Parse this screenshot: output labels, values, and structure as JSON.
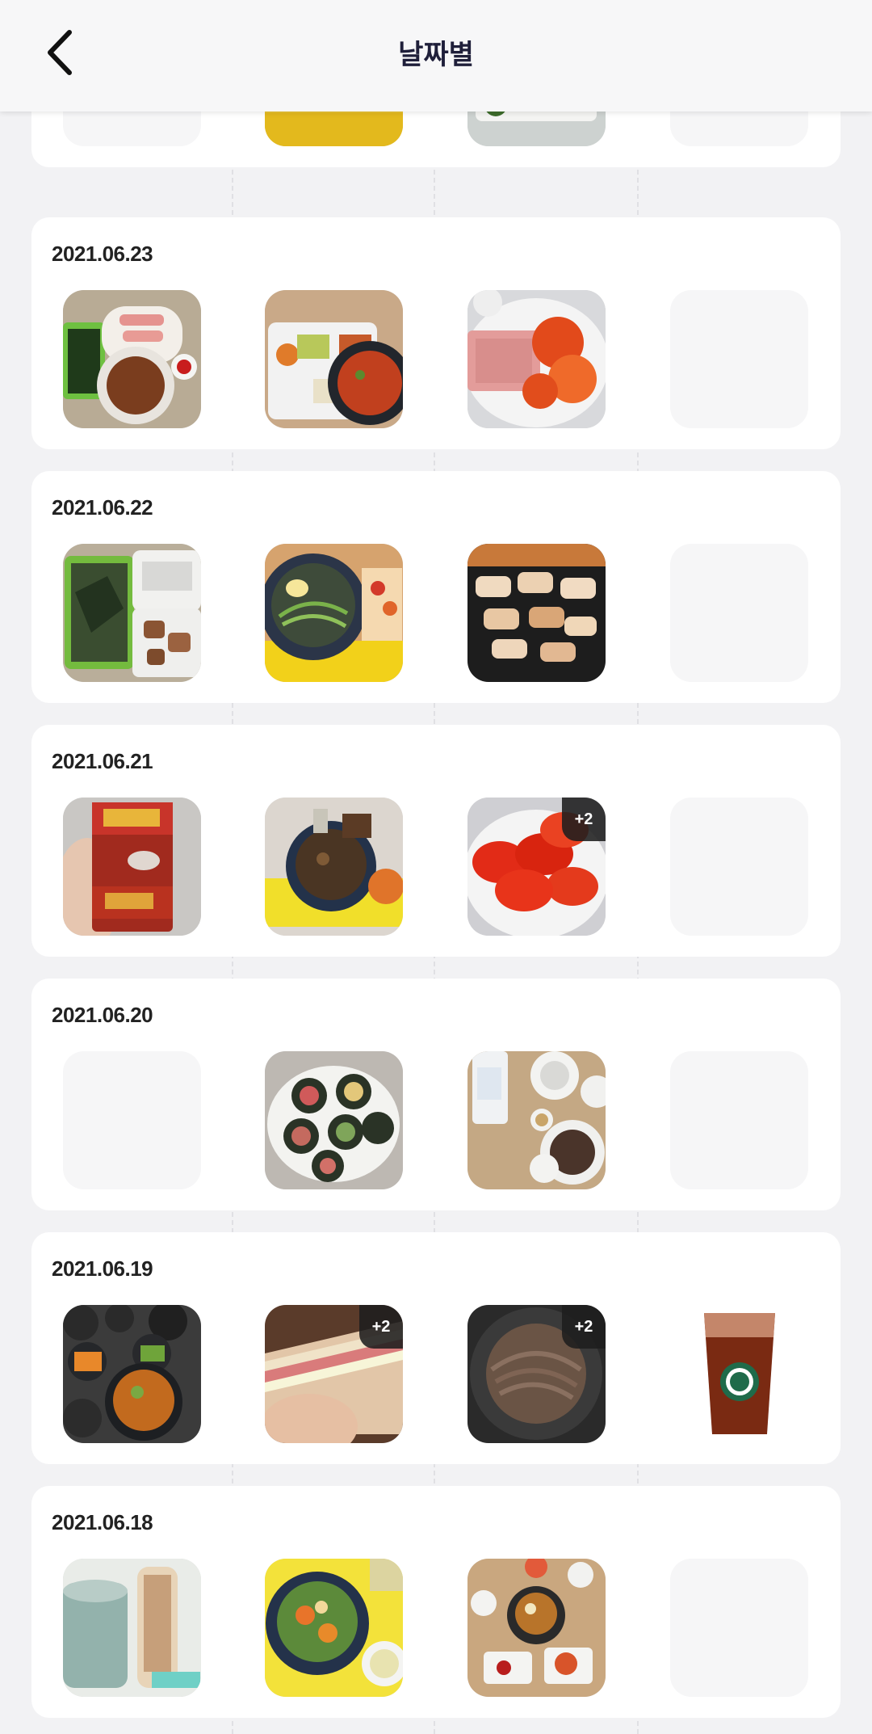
{
  "header": {
    "title": "날짜별",
    "back_icon": "chevron-left-icon"
  },
  "colors": {
    "title": "#1f1f3a",
    "background": "#f2f2f4",
    "card": "#ffffff",
    "empty_tile": "#f6f6f7"
  },
  "days": [
    {
      "date": "",
      "tiles": [
        {
          "kind": "empty"
        },
        {
          "kind": "photo",
          "subject": "tray-red-soup"
        },
        {
          "kind": "photo",
          "subject": "fish-sashimi-plate"
        },
        {
          "kind": "empty"
        }
      ]
    },
    {
      "date": "2021.06.23",
      "tiles": [
        {
          "kind": "photo",
          "subject": "lunchbox-seaweed-ham"
        },
        {
          "kind": "photo",
          "subject": "white-tray-spicy-stew"
        },
        {
          "kind": "photo",
          "subject": "spam-and-tomato"
        },
        {
          "kind": "empty"
        }
      ]
    },
    {
      "date": "2021.06.22",
      "tiles": [
        {
          "kind": "photo",
          "subject": "seaweed-box-meat"
        },
        {
          "kind": "photo",
          "subject": "cold-noodles-tray"
        },
        {
          "kind": "photo",
          "subject": "grilled-pork-belly"
        },
        {
          "kind": "empty"
        }
      ]
    },
    {
      "date": "2021.06.21",
      "tiles": [
        {
          "kind": "photo",
          "subject": "snack-package"
        },
        {
          "kind": "photo",
          "subject": "soup-bowl-yellow-tray"
        },
        {
          "kind": "photo",
          "subject": "sliced-tomatoes",
          "badge": "+2"
        },
        {
          "kind": "empty"
        }
      ]
    },
    {
      "date": "2021.06.20",
      "tiles": [
        {
          "kind": "empty"
        },
        {
          "kind": "photo",
          "subject": "kimbap-rolls"
        },
        {
          "kind": "photo",
          "subject": "makgeolli-and-side-dishes"
        },
        {
          "kind": "empty"
        }
      ]
    },
    {
      "date": "2021.06.19",
      "tiles": [
        {
          "kind": "photo",
          "subject": "korean-table-stew"
        },
        {
          "kind": "photo",
          "subject": "sandwich-in-hand",
          "badge": "+2"
        },
        {
          "kind": "photo",
          "subject": "buckwheat-noodles",
          "badge": "+2"
        },
        {
          "kind": "drink",
          "subject": "iced-coffee-cup"
        }
      ]
    },
    {
      "date": "2021.06.18",
      "tiles": [
        {
          "kind": "photo",
          "subject": "mug-and-sandwich"
        },
        {
          "kind": "photo",
          "subject": "salad-bowl-yellow-tray"
        },
        {
          "kind": "photo",
          "subject": "korean-stew-table"
        },
        {
          "kind": "empty"
        }
      ]
    }
  ]
}
